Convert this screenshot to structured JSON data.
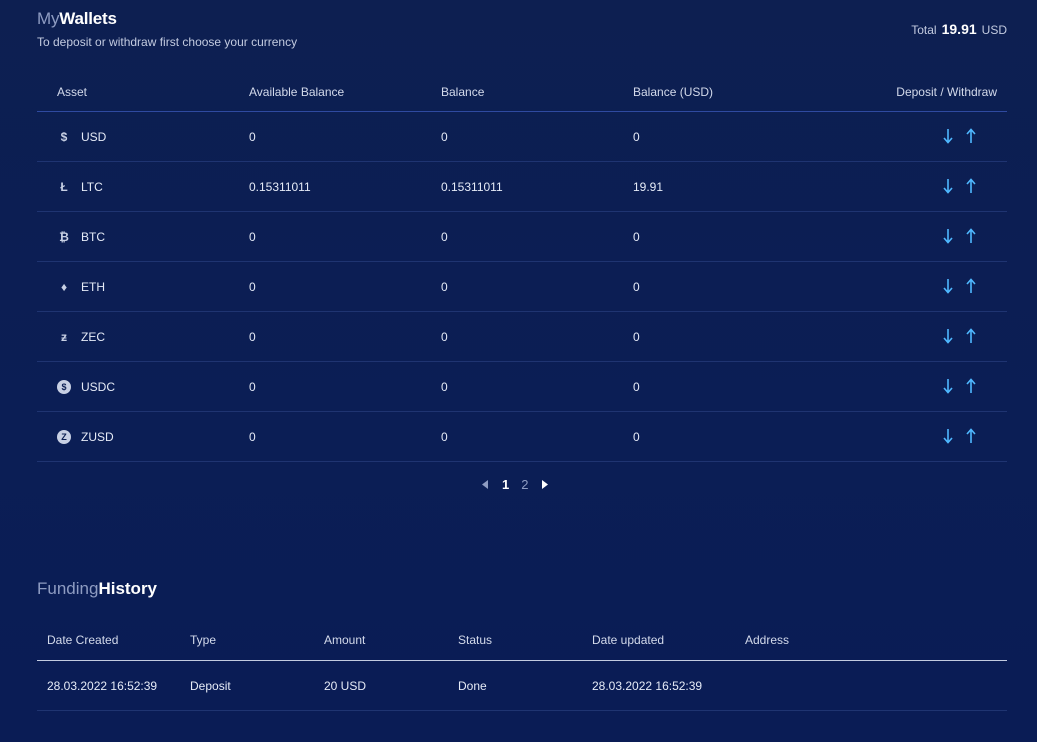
{
  "header": {
    "title_muted": "My",
    "title_strong": "Wallets",
    "subtitle": "To deposit or withdraw first choose your currency",
    "total_label": "Total",
    "total_amount": "19.91",
    "total_currency": "USD"
  },
  "wallet_table": {
    "columns": {
      "asset": "Asset",
      "available": "Available Balance",
      "balance": "Balance",
      "balance_usd": "Balance (USD)",
      "actions": "Deposit / Withdraw"
    },
    "rows": [
      {
        "icon": "dollar-icon",
        "glyph": "$",
        "asset": "USD",
        "available": "0",
        "balance": "0",
        "balance_usd": "0"
      },
      {
        "icon": "litecoin-icon",
        "glyph": "Ł",
        "asset": "LTC",
        "available": "0.15311011",
        "balance": "0.15311011",
        "balance_usd": "19.91"
      },
      {
        "icon": "bitcoin-icon",
        "glyph": "₿",
        "asset": "BTC",
        "available": "0",
        "balance": "0",
        "balance_usd": "0"
      },
      {
        "icon": "ethereum-icon",
        "glyph": "♦",
        "asset": "ETH",
        "available": "0",
        "balance": "0",
        "balance_usd": "0"
      },
      {
        "icon": "zcash-icon",
        "glyph": "ƶ",
        "asset": "ZEC",
        "available": "0",
        "balance": "0",
        "balance_usd": "0"
      },
      {
        "icon": "usdc-icon",
        "glyph": "$",
        "asset": "USDC",
        "available": "0",
        "balance": "0",
        "balance_usd": "0"
      },
      {
        "icon": "zusd-icon",
        "glyph": "Z",
        "asset": "ZUSD",
        "available": "0",
        "balance": "0",
        "balance_usd": "0"
      }
    ]
  },
  "pagination": {
    "pages": [
      "1",
      "2"
    ],
    "current": "1"
  },
  "funding": {
    "title_muted": "Funding",
    "title_strong": "History",
    "columns": {
      "date_created": "Date Created",
      "type": "Type",
      "amount": "Amount",
      "status": "Status",
      "date_updated": "Date updated",
      "address": "Address"
    },
    "rows": [
      {
        "date_created": "28.03.2022 16:52:39",
        "type": "Deposit",
        "amount": "20 USD",
        "status": "Done",
        "date_updated": "28.03.2022 16:52:39",
        "address": ""
      }
    ]
  },
  "colors": {
    "background": "#0c1f52",
    "accent_arrow": "#4fb8ff",
    "muted_text": "#8e9cc2"
  }
}
